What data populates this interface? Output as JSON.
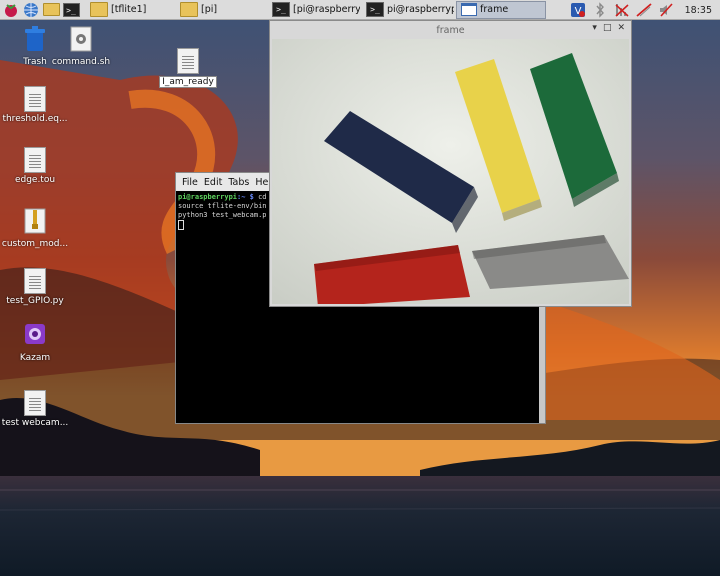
{
  "taskbar": {
    "windows": [
      {
        "label": "[tflite1]",
        "type": "folder"
      },
      {
        "label": "[pi]",
        "type": "folder"
      },
      {
        "label": "[pi@raspberrypi:...",
        "type": "terminal"
      },
      {
        "label": "pi@raspberrypi: ~",
        "type": "terminal"
      },
      {
        "label": "frame",
        "type": "frame"
      }
    ],
    "clock": "18:35"
  },
  "desktop": {
    "icons": [
      {
        "label": "Trash",
        "icon": "trash-icon"
      },
      {
        "label": "command.sh",
        "icon": "script-icon"
      },
      {
        "label": "I_am_ready",
        "icon": "text-file-icon"
      },
      {
        "label": "threshold.eq...",
        "icon": "text-file-icon"
      },
      {
        "label": "edge.tou",
        "icon": "text-file-icon"
      },
      {
        "label": "custom_mod...",
        "icon": "zip-file-icon"
      },
      {
        "label": "test_GPIO.py",
        "icon": "text-file-icon"
      },
      {
        "label": "Kazam",
        "icon": "kazam-icon"
      },
      {
        "label": "test webcam...",
        "icon": "text-file-icon"
      }
    ]
  },
  "terminal": {
    "menu": [
      "File",
      "Edit",
      "Tabs",
      "Hel"
    ],
    "prompt_user": "pi@raspberrypi",
    "prompt_path": ":~ $",
    "lines": [
      "cd",
      "source tflite-env/bin",
      "python3 test_webcam.p"
    ]
  },
  "frame_window": {
    "title": "frame"
  },
  "colors": {
    "block_blue": "#1f2a48",
    "block_yellow": "#e8d24a",
    "block_green": "#1c6a3a",
    "block_red": "#b4241c",
    "block_gray": "#8a8a88"
  }
}
